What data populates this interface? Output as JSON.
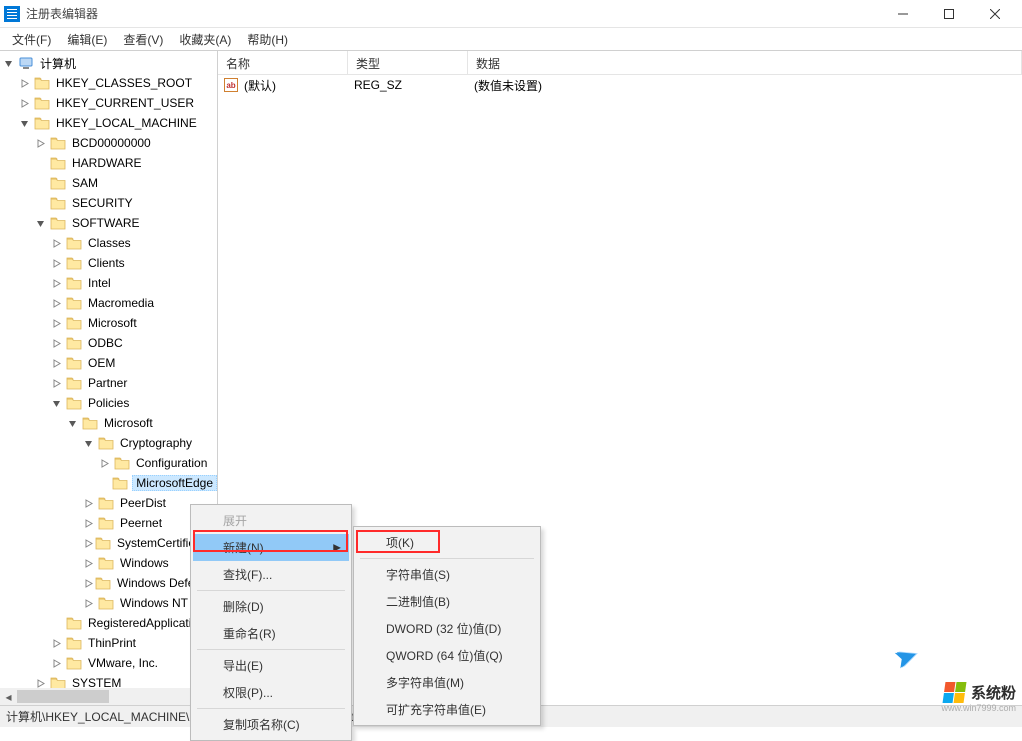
{
  "title": "注册表编辑器",
  "window_controls": {
    "min": "—",
    "max": "☐",
    "close": "✕"
  },
  "menu": [
    "文件(F)",
    "编辑(E)",
    "查看(V)",
    "收藏夹(A)",
    "帮助(H)"
  ],
  "tree": {
    "root": "计算机",
    "hives": [
      {
        "name": "HKEY_CLASSES_ROOT",
        "depth": 1,
        "exp": "closed"
      },
      {
        "name": "HKEY_CURRENT_USER",
        "depth": 1,
        "exp": "closed"
      },
      {
        "name": "HKEY_LOCAL_MACHINE",
        "depth": 1,
        "exp": "open"
      },
      {
        "name": "BCD00000000",
        "depth": 2,
        "exp": "closed"
      },
      {
        "name": "HARDWARE",
        "depth": 2,
        "exp": "none"
      },
      {
        "name": "SAM",
        "depth": 2,
        "exp": "none"
      },
      {
        "name": "SECURITY",
        "depth": 2,
        "exp": "none"
      },
      {
        "name": "SOFTWARE",
        "depth": 2,
        "exp": "open"
      },
      {
        "name": "Classes",
        "depth": 3,
        "exp": "closed"
      },
      {
        "name": "Clients",
        "depth": 3,
        "exp": "closed"
      },
      {
        "name": "Intel",
        "depth": 3,
        "exp": "closed"
      },
      {
        "name": "Macromedia",
        "depth": 3,
        "exp": "closed"
      },
      {
        "name": "Microsoft",
        "depth": 3,
        "exp": "closed"
      },
      {
        "name": "ODBC",
        "depth": 3,
        "exp": "closed"
      },
      {
        "name": "OEM",
        "depth": 3,
        "exp": "closed"
      },
      {
        "name": "Partner",
        "depth": 3,
        "exp": "closed"
      },
      {
        "name": "Policies",
        "depth": 3,
        "exp": "open"
      },
      {
        "name": "Microsoft",
        "depth": 4,
        "exp": "open"
      },
      {
        "name": "Cryptography",
        "depth": 5,
        "exp": "open"
      },
      {
        "name": "Configuration",
        "depth": 6,
        "exp": "closed"
      },
      {
        "name": "MicrosoftEdge",
        "depth": 6,
        "exp": "none",
        "selected": true
      },
      {
        "name": "PeerDist",
        "depth": 5,
        "exp": "closed"
      },
      {
        "name": "Peernet",
        "depth": 5,
        "exp": "closed"
      },
      {
        "name": "SystemCertificates",
        "depth": 5,
        "exp": "closed"
      },
      {
        "name": "Windows",
        "depth": 5,
        "exp": "closed"
      },
      {
        "name": "Windows Defender",
        "depth": 5,
        "exp": "closed"
      },
      {
        "name": "Windows NT",
        "depth": 5,
        "exp": "closed"
      },
      {
        "name": "RegisteredApplications",
        "depth": 3,
        "exp": "none"
      },
      {
        "name": "ThinPrint",
        "depth": 3,
        "exp": "closed"
      },
      {
        "name": "VMware, Inc.",
        "depth": 3,
        "exp": "closed"
      },
      {
        "name": "SYSTEM",
        "depth": 2,
        "exp": "closed"
      }
    ]
  },
  "list": {
    "headers": {
      "name": "名称",
      "type": "类型",
      "data": "数据"
    },
    "rows": [
      {
        "icon": "ab",
        "name": "(默认)",
        "type": "REG_SZ",
        "data": "(数值未设置)"
      }
    ]
  },
  "context_menu_1": {
    "items": [
      {
        "label": "展开",
        "disabled": true
      },
      {
        "label": "新建(N)",
        "submenu": true,
        "highlighted": true
      },
      {
        "label": "查找(F)..."
      },
      {
        "sep": true
      },
      {
        "label": "删除(D)"
      },
      {
        "label": "重命名(R)"
      },
      {
        "sep": true
      },
      {
        "label": "导出(E)"
      },
      {
        "label": "权限(P)..."
      },
      {
        "sep": true
      },
      {
        "label": "复制项名称(C)"
      }
    ]
  },
  "context_menu_2": {
    "items": [
      {
        "label": "项(K)"
      },
      {
        "sep": true
      },
      {
        "label": "字符串值(S)"
      },
      {
        "label": "二进制值(B)"
      },
      {
        "label": "DWORD (32 位)值(D)"
      },
      {
        "label": "QWORD (64 位)值(Q)"
      },
      {
        "label": "多字符串值(M)"
      },
      {
        "label": "可扩充字符串值(E)"
      }
    ]
  },
  "statusbar": "计算机\\HKEY_LOCAL_MACHINE\\SOFTWARE\\Policies\\Microsoft\\Cryptography\\MicrosoftEdge",
  "watermark": {
    "text": "系统粉",
    "sub": "www.win7999.com"
  }
}
